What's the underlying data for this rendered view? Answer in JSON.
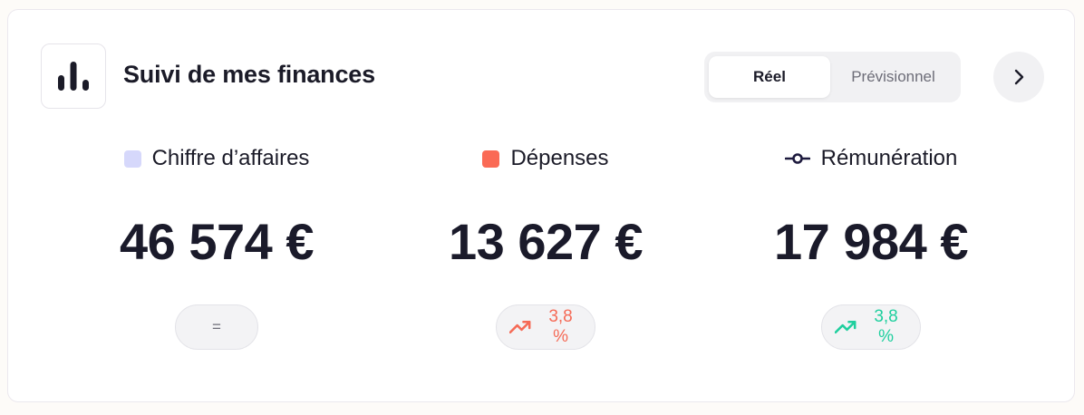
{
  "header": {
    "title": "Suivi de mes finances",
    "logo_icon": "bar-chart-icon"
  },
  "toggle": {
    "options": [
      "Réel",
      "Prévisionnel"
    ],
    "selected": "Réel"
  },
  "next_button": {
    "icon": "chevron-right-icon"
  },
  "metrics": [
    {
      "label": "Chiffre d’affaires",
      "legend_icon": "square-swatch-icon",
      "legend_color": "#d6d8fb",
      "value": "46 574 €",
      "trend": {
        "text": "=",
        "direction": "flat",
        "color": "#6d6d78"
      }
    },
    {
      "label": "Dépenses",
      "legend_icon": "square-swatch-icon",
      "legend_color": "#fa6a55",
      "value": "13 627 €",
      "trend": {
        "text": "3,8 %",
        "direction": "up",
        "icon": "trending-up-icon",
        "color": "#f56b57"
      }
    },
    {
      "label": "Rémunération",
      "legend_icon": "line-marker-icon",
      "legend_color": "#1d1a3e",
      "value": "17 984 €",
      "trend": {
        "text": "3,8 %",
        "direction": "up",
        "icon": "trending-up-icon",
        "color": "#1fcf9e"
      }
    }
  ]
}
